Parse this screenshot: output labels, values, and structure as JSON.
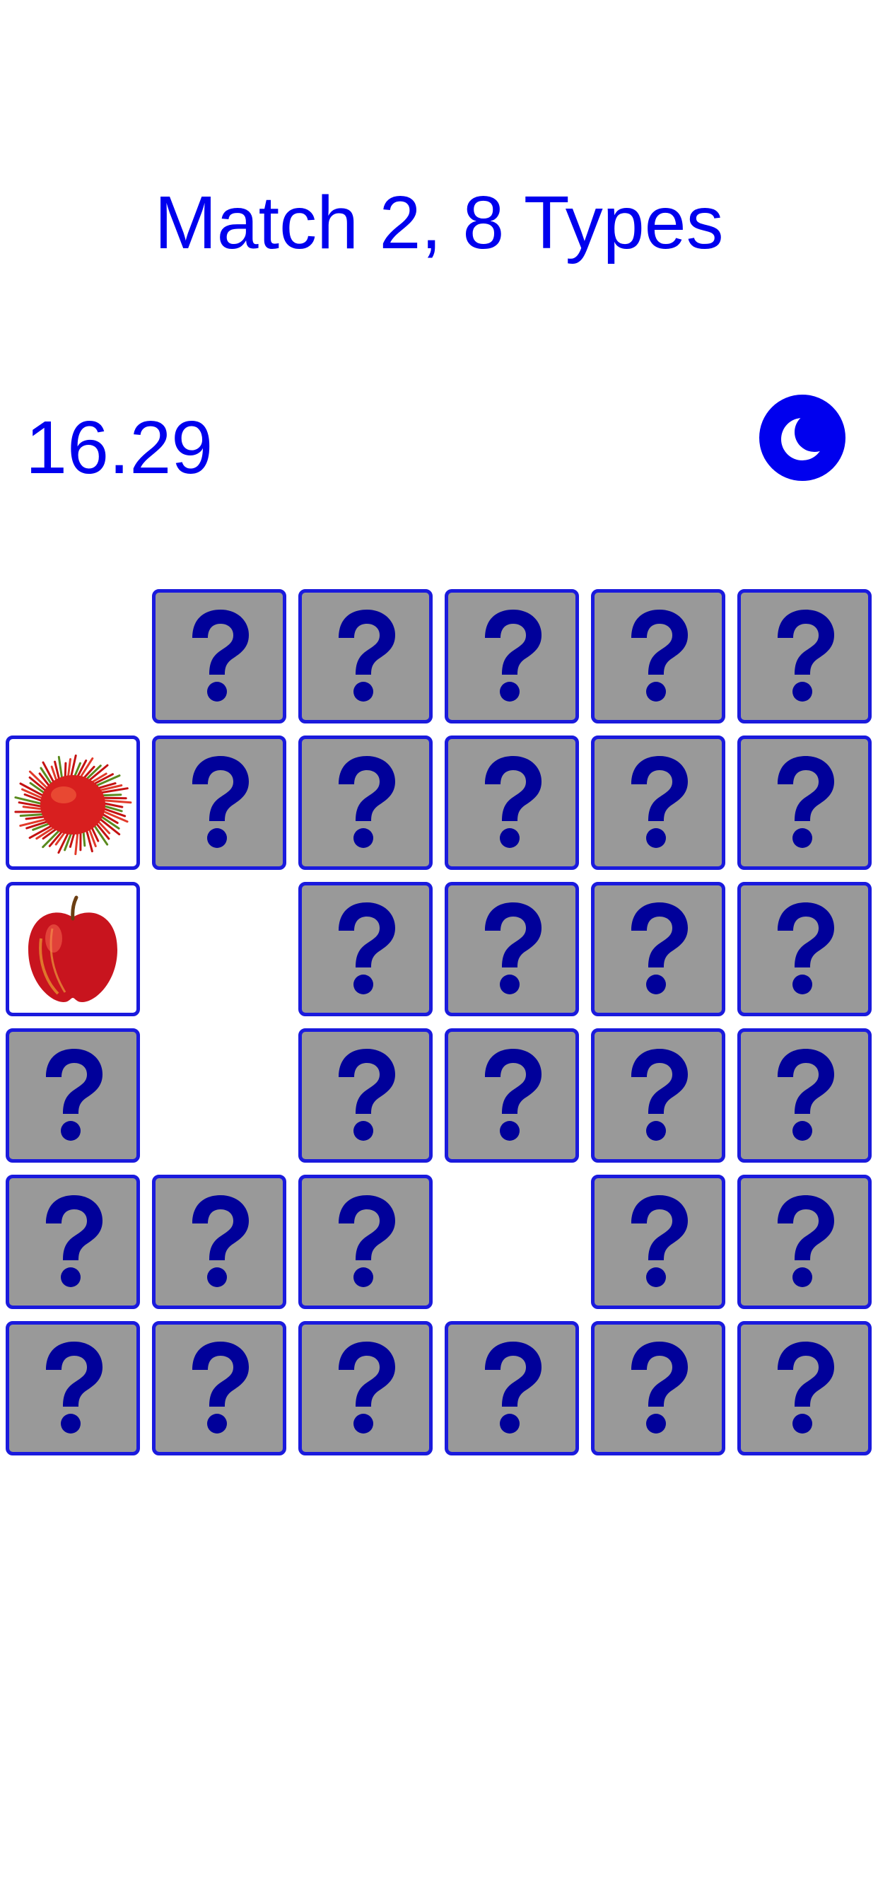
{
  "header": {
    "title": "Match 2, 8 Types"
  },
  "status": {
    "timer": "16.29",
    "theme_toggle_icon": "moon-icon"
  },
  "colors": {
    "accent": "#0000ee",
    "card_border": "#1a1add",
    "card_back": "#999999",
    "question_mark": "#00009a"
  },
  "board": {
    "rows": 6,
    "cols": 6,
    "cards": [
      [
        "empty",
        "hidden",
        "hidden",
        "hidden",
        "hidden",
        "hidden"
      ],
      [
        "rambutan",
        "hidden",
        "hidden",
        "hidden",
        "hidden",
        "hidden"
      ],
      [
        "apple",
        "empty",
        "hidden",
        "hidden",
        "hidden",
        "hidden"
      ],
      [
        "hidden",
        "empty",
        "hidden",
        "hidden",
        "hidden",
        "hidden"
      ],
      [
        "hidden",
        "hidden",
        "hidden",
        "empty",
        "hidden",
        "hidden"
      ],
      [
        "hidden",
        "hidden",
        "hidden",
        "hidden",
        "hidden",
        "hidden"
      ]
    ]
  }
}
